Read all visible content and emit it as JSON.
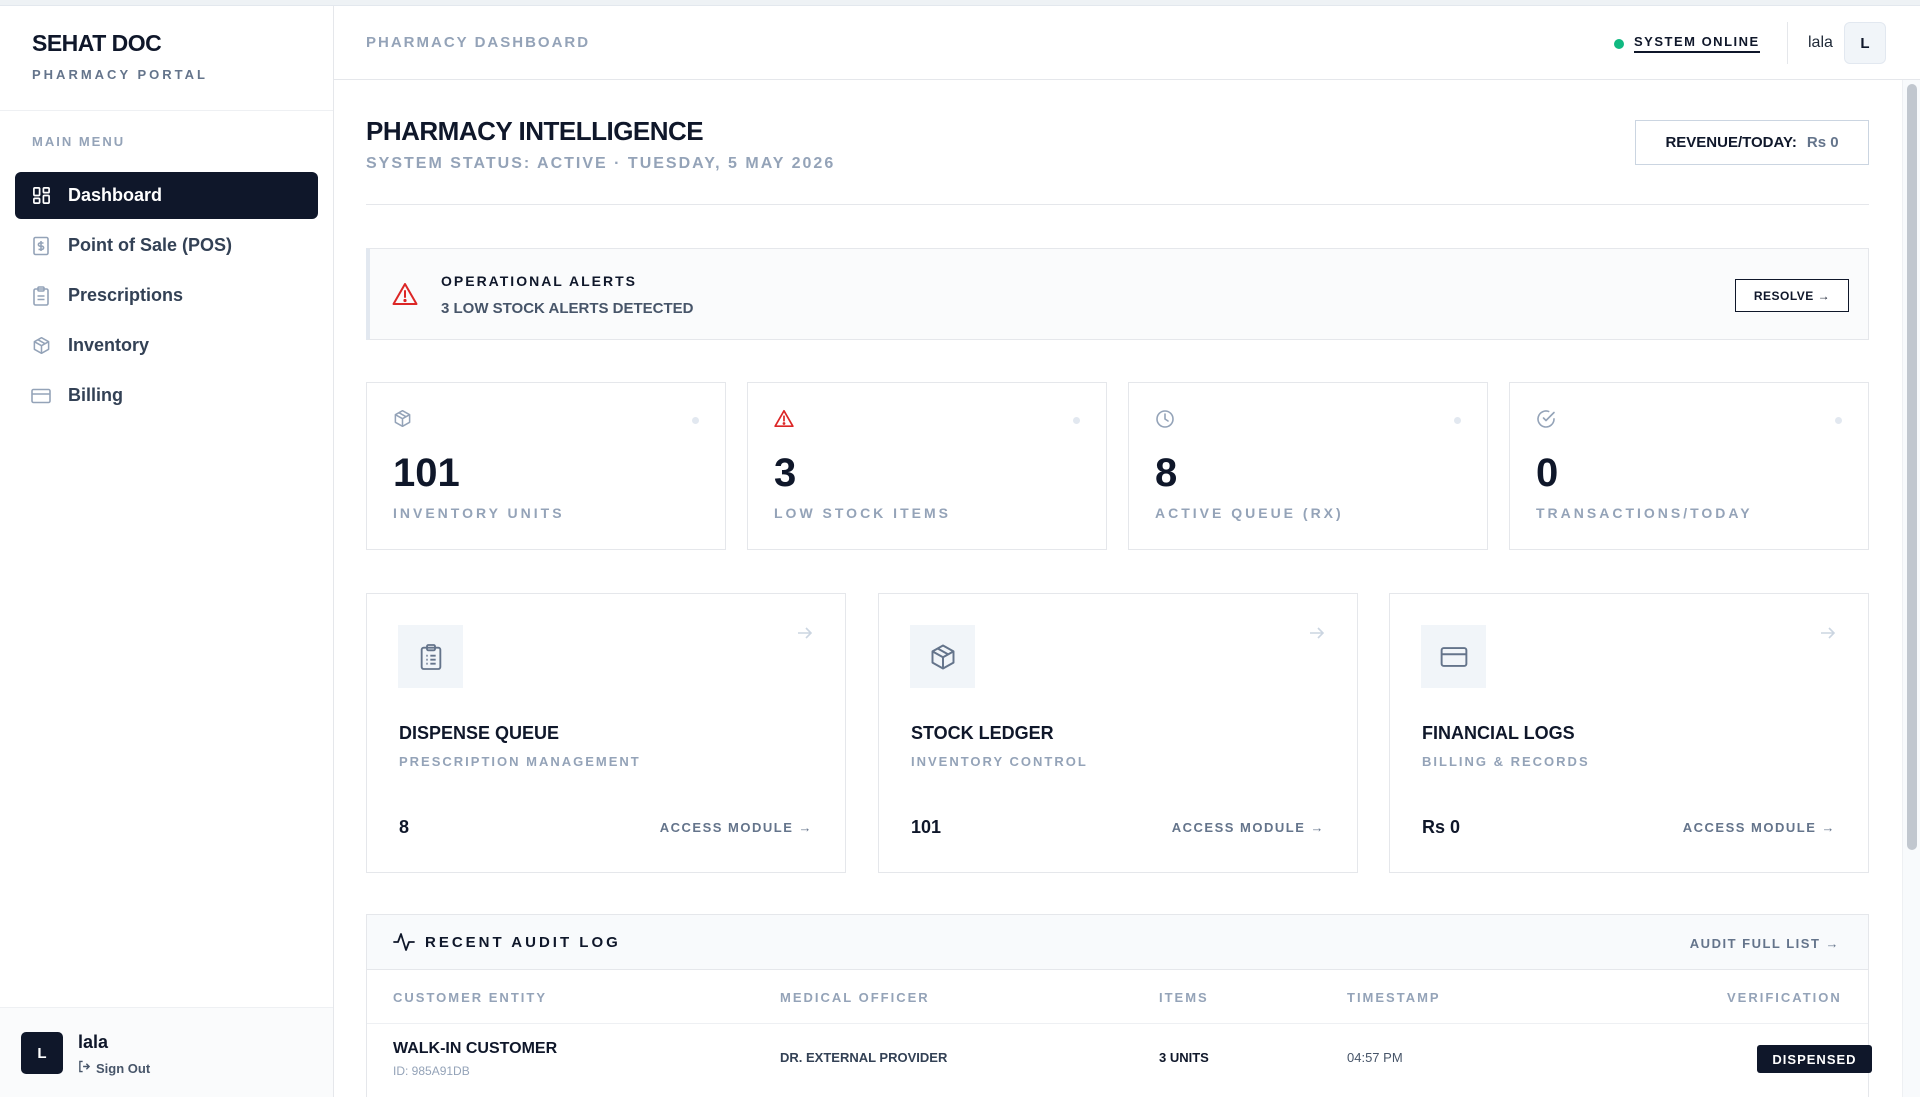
{
  "brand": {
    "title": "SEHAT DOC",
    "subtitle": "PHARMACY PORTAL"
  },
  "sidebar": {
    "menu_heading": "MAIN MENU",
    "items": [
      {
        "label": "Dashboard",
        "icon": "dashboard-grid-icon",
        "active": true
      },
      {
        "label": "Point of Sale (POS)",
        "icon": "receipt-icon"
      },
      {
        "label": "Prescriptions",
        "icon": "clipboard-icon"
      },
      {
        "label": "Inventory",
        "icon": "package-icon"
      },
      {
        "label": "Billing",
        "icon": "credit-card-icon"
      }
    ],
    "footer": {
      "avatar": "L",
      "name": "lala",
      "sign_out": "Sign Out"
    }
  },
  "header": {
    "title": "PHARMACY DASHBOARD",
    "status": "SYSTEM ONLINE",
    "user": "lala",
    "avatar": "L"
  },
  "page": {
    "title": "PHARMACY INTELLIGENCE",
    "subtitle": "SYSTEM STATUS: ACTIVE · TUESDAY, 5 MAY 2026",
    "revenue_label": "REVENUE/TODAY:",
    "revenue_value": "Rs 0"
  },
  "alert": {
    "title": "OPERATIONAL ALERTS",
    "message": "3 LOW STOCK ALERTS DETECTED",
    "button": "RESOLVE →"
  },
  "stats": [
    {
      "value": "101",
      "label": "INVENTORY UNITS",
      "icon": "package-icon"
    },
    {
      "value": "3",
      "label": "LOW STOCK ITEMS",
      "icon": "warning-triangle-icon"
    },
    {
      "value": "8",
      "label": "ACTIVE QUEUE (RX)",
      "icon": "clock-icon"
    },
    {
      "value": "0",
      "label": "TRANSACTIONS/TODAY",
      "icon": "check-circle-icon"
    }
  ],
  "modules": [
    {
      "title": "DISPENSE QUEUE",
      "subtitle": "PRESCRIPTION MANAGEMENT",
      "value": "8",
      "link": "ACCESS MODULE →",
      "icon": "clipboard-icon"
    },
    {
      "title": "STOCK LEDGER",
      "subtitle": "INVENTORY CONTROL",
      "value": "101",
      "link": "ACCESS MODULE →",
      "icon": "package-icon"
    },
    {
      "title": "FINANCIAL LOGS",
      "subtitle": "BILLING & RECORDS",
      "value": "Rs 0",
      "link": "ACCESS MODULE →",
      "icon": "credit-card-icon"
    }
  ],
  "audit": {
    "title": "RECENT AUDIT LOG",
    "link": "AUDIT FULL LIST →",
    "columns": [
      "CUSTOMER ENTITY",
      "MEDICAL OFFICER",
      "ITEMS",
      "TIMESTAMP",
      "VERIFICATION"
    ],
    "rows": [
      {
        "customer": "WALK-IN CUSTOMER",
        "id": "ID: 985A91DB",
        "officer": "DR. EXTERNAL PROVIDER",
        "items": "3 UNITS",
        "timestamp": "04:57 PM",
        "status": "DISPENSED"
      }
    ]
  },
  "colors": {
    "primary": "#0f172a",
    "online": "#10b981",
    "alert": "#dc2626",
    "muted": "#94a3b8"
  }
}
